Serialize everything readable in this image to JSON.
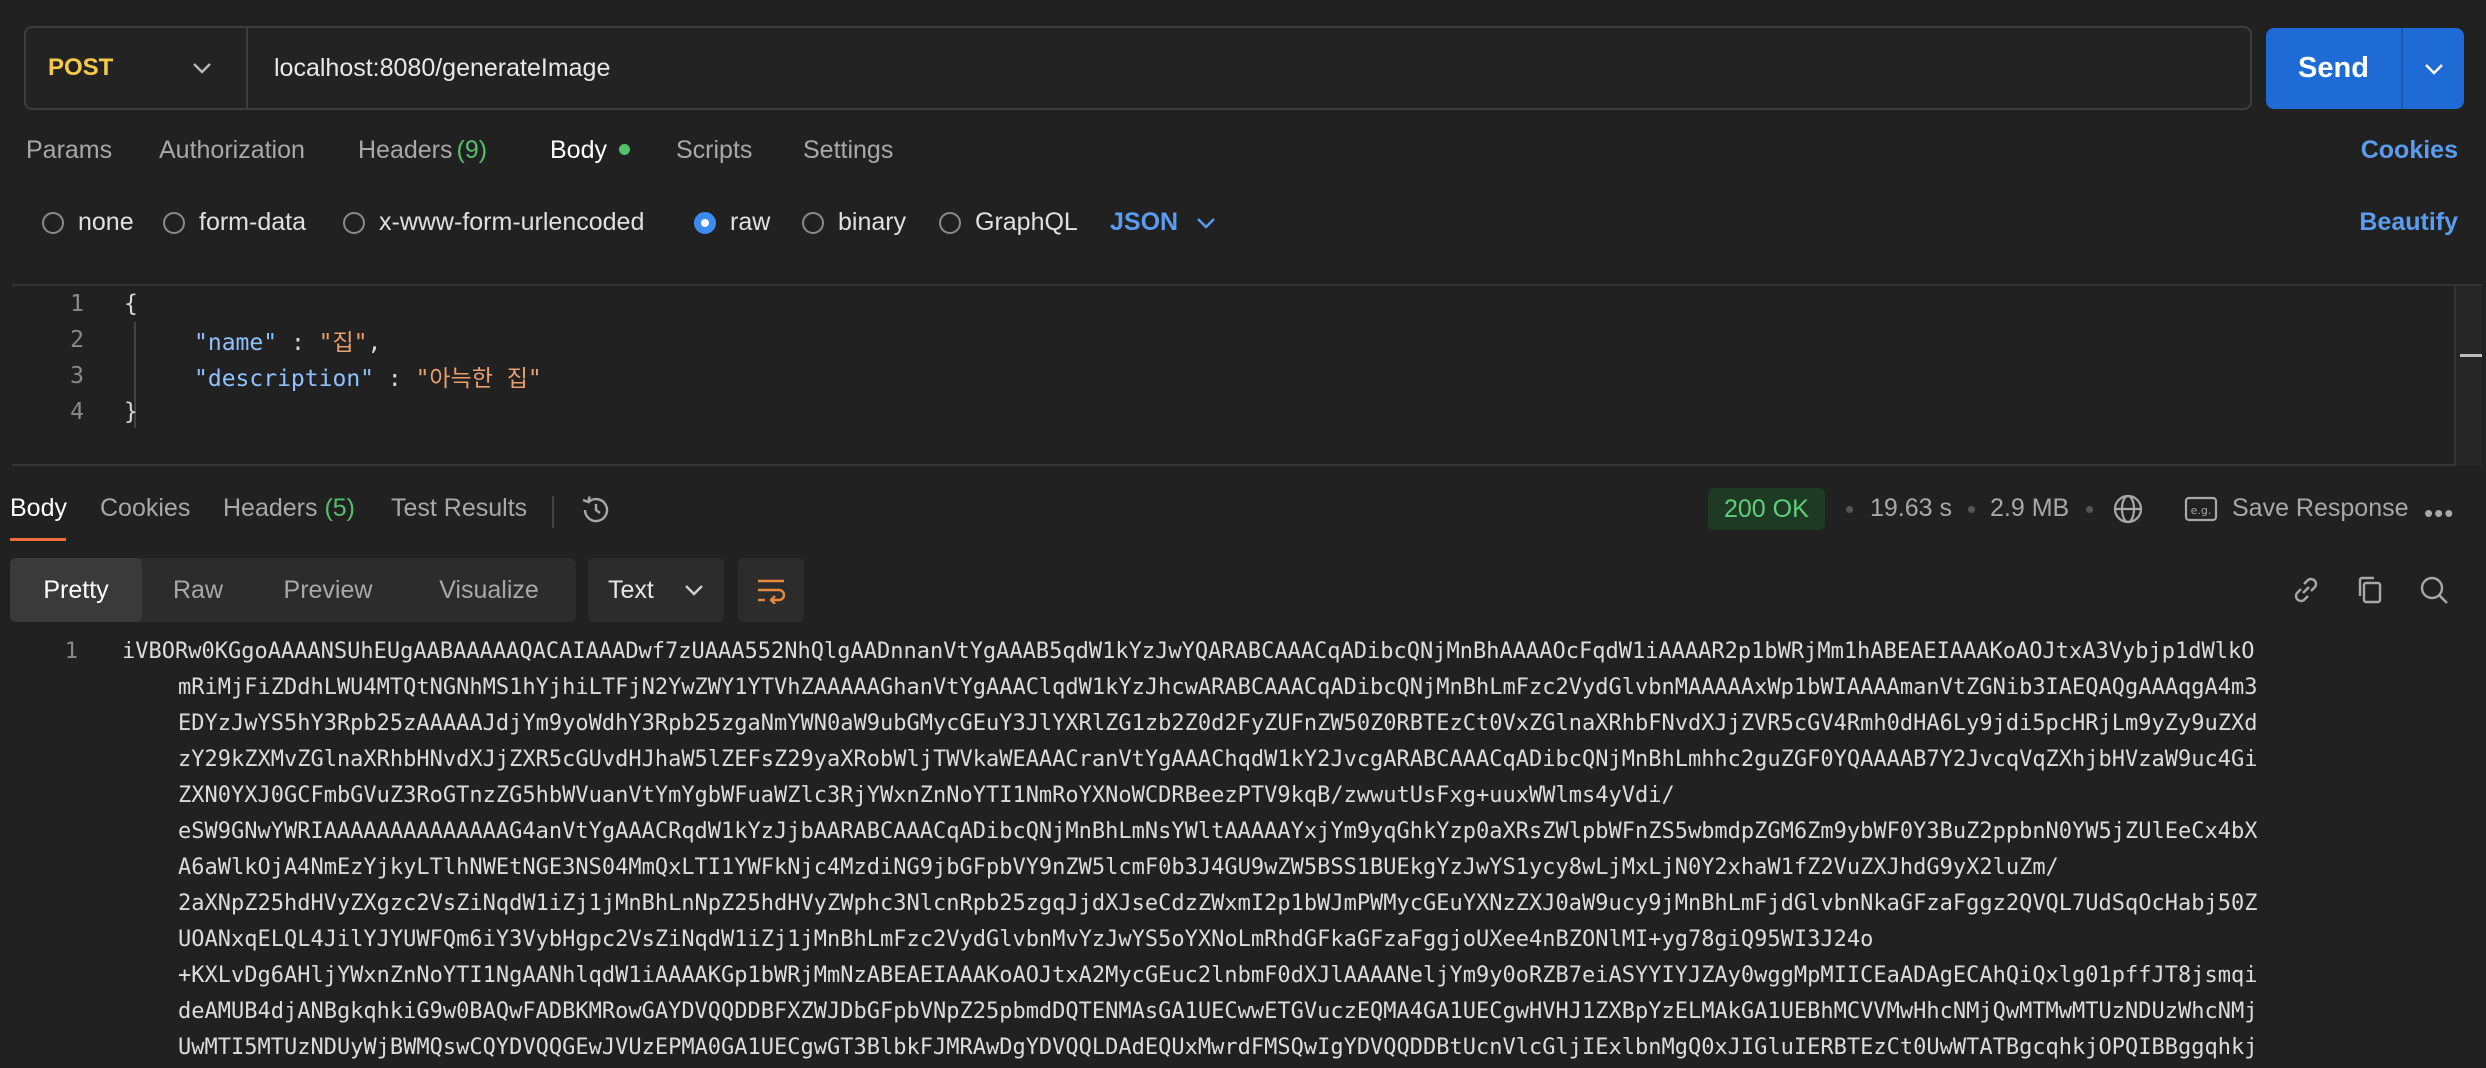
{
  "request": {
    "method": "POST",
    "url": "localhost:8080/generateImage",
    "send_label": "Send"
  },
  "request_tabs": {
    "params": "Params",
    "authorization": "Authorization",
    "headers": "Headers",
    "headers_count": "(9)",
    "body": "Body",
    "scripts": "Scripts",
    "settings": "Settings",
    "cookies": "Cookies"
  },
  "body_options": {
    "none": "none",
    "form_data": "form-data",
    "urlencoded": "x-www-form-urlencoded",
    "raw": "raw",
    "binary": "binary",
    "graphql": "GraphQL",
    "language": "JSON",
    "beautify": "Beautify",
    "selected": "raw"
  },
  "editor": {
    "line_numbers": [
      "1",
      "2",
      "3",
      "4"
    ],
    "open_brace": "{",
    "close_brace": "}",
    "name_key": "\"name\"",
    "name_value": "\"집\"",
    "description_key": "\"description\"",
    "description_value": "\"아늑한 집\"",
    "colon": " : ",
    "comma": ","
  },
  "response_tabs": {
    "body": "Body",
    "cookies": "Cookies",
    "headers": "Headers",
    "headers_count": "(5)",
    "test_results": "Test Results",
    "status": "200 OK",
    "time": "19.63 s",
    "size": "2.9 MB",
    "save_response": "Save Response"
  },
  "view_toolbar": {
    "pretty": "Pretty",
    "raw": "Raw",
    "preview": "Preview",
    "visualize": "Visualize",
    "format": "Text"
  },
  "response_body": {
    "line_number": "1",
    "lines": [
      "iVBORw0KGgoAAAANSUhEUgAABAAAAAQACAIAAADwf7zUAAA552NhQlgAADnnanVtYgAAAB5qdW1kYzJwYQARABCAAACqADibcQNjMnBhAAAAOcFqdW1iAAAAR2p1bWRjMm1hABEAEIAAAKoAOJtxA3Vybjp1dWlkO",
      "mRiMjFiZDdhLWU4MTQtNGNhMS1hYjhiLTFjN2YwZWY1YTVhZAAAAAGhanVtYgAAAClqdW1kYzJhcwARABCAAACqADibcQNjMnBhLmFzc2VydGlvbnMAAAAAxWp1bWIAAAAmanVtZGNib3IAEQAQgAAAqgA4m3",
      "EDYzJwYS5hY3Rpb25zAAAAAJdjYm9yoWdhY3Rpb25zgaNmYWN0aW9ubGMycGEuY3JlYXRlZG1zb2Z0d2FyZUFnZW50Z0RBTEzCt0VxZGlnaXRhbFNvdXJjZVR5cGV4Rmh0dHA6Ly9jdi5pcHRjLm9yZy9uZXd",
      "zY29kZXMvZGlnaXRhbHNvdXJjZXR5cGUvdHJhaW5lZEFsZ29yaXRobWljTWVkaWEAAACranVtYgAAAChqdW1kY2JvcgARABCAAACqADibcQNjMnBhLmhhc2guZGF0YQAAAAB7Y2JvcqVqZXhjbHVzaW9uc4Gi",
      "ZXN0YXJ0GCFmbGVuZ3RoGTnzZG5hbWVuanVtYmYgbWFuaWZlc3RjYWxnZnNoYTI1NmRoYXNoWCDRBeezPTV9kqB/zwwutUsFxg+uuxWWlms4yVdi/",
      "eSW9GNwYWRIAAAAAAAAAAAAAAG4anVtYgAAACRqdW1kYzJjbAARABCAAACqADibcQNjMnBhLmNsYWltAAAAAYxjYm9yqGhkYzp0aXRsZWlpbWFnZS5wbmdpZGM6Zm9ybWF0Y3BuZ2ppbnN0YW5jZUlEeCx4bX",
      "A6aWlkOjA4NmEzYjkyLTlhNWEtNGE3NS04MmQxLTI1YWFkNjc4MzdiNG9jbGFpbVY9nZW5lcmF0b3J4GU9wZW5BSS1BUEkgYzJwYS1ycy8wLjMxLjN0Y2xhaW1fZ2VuZXJhdG9yX2luZm/",
      "2aXNpZ25hdHVyZXgzc2VsZiNqdW1iZj1jMnBhLnNpZ25hdHVyZWphc3NlcnRpb25zgqJjdXJseCdzZWxmI2p1bWJmPWMycGEuYXNzZXJ0aW9ucy9jMnBhLmFjdGlvbnNkaGFzaFggz2QVQL7UdSqOcHabj50Z",
      "UOANxqELQL4JilYJYUWFQm6iY3VybHgpc2VsZiNqdW1iZj1jMnBhLmFzc2VydGlvbnMvYzJwYS5oYXNoLmRhdGFkaGFzaFggjoUXee4nBZONlMI+yg78giQ95WI3J24o",
      "+KXLvDg6AHljYWxnZnNoYTI1NgAANhlqdW1iAAAAKGp1bWRjMmNzABEAEIAAAKoAOJtxA2MycGEuc2lnbmF0dXJlAAAANeljYm9y0oRZB7eiASYYIYJZAy0wggMpMIICEaADAgECAhQiQxlg01pffJT8jsmqi",
      "deAMUB4djANBgkqhkiG9w0BAQwFADBKMRowGAYDVQQDDBFXZWJDbGFpbVNpZ25pbmdDQTENMAsGA1UECwwETGVuczEQMA4GA1UECgwHVHJ1ZXBpYzELMAkGA1UEBhMCVVMwHhcNMjQwMTMwMTUzNDUzWhcNMj",
      "UwMTI5MTUzNDUyWjBWMQswCQYDVQQGEwJVUzEPMA0GA1UECgwGT3BlbkFJMRAwDgYDVQQLDAdEQUxMwrdFMSQwIgYDVQQDDBtUcnVlcGljIExlbnMgQ0xJIGluIERBTEzCt0UwWTATBgcqhkjOPQIBBggqhkj"
    ]
  }
}
